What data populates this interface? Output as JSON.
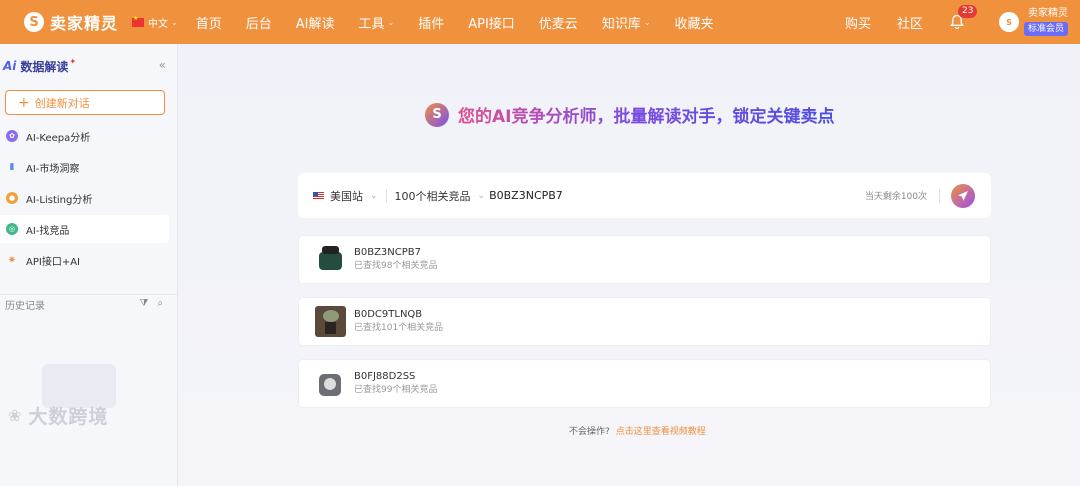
{
  "topnav": {
    "brand": "卖家精灵",
    "lang": "中文",
    "items": [
      "首页",
      "后台",
      "AI解读",
      "工具",
      "插件",
      "API接口",
      "优麦云",
      "知识库",
      "收藏夹"
    ],
    "right_items": [
      "购买",
      "社区"
    ],
    "notification_count": "23",
    "user_name": "卖家精灵",
    "member_badge": "标准会员"
  },
  "sidebar": {
    "title": "数据解读",
    "new_chat": "创建新对话",
    "items": [
      {
        "label": "AI-Keepa分析",
        "icon": "keepa-icon",
        "color": "#8a6cf0"
      },
      {
        "label": "AI-市场洞察",
        "icon": "bar-chart-icon",
        "color": "#5b8cf0"
      },
      {
        "label": "AI-Listing分析",
        "icon": "listing-icon",
        "color": "#f0a03e"
      },
      {
        "label": "AI-找竞品",
        "icon": "competitor-icon",
        "color": "#3fb98a"
      },
      {
        "label": "API接口+AI",
        "icon": "api-icon",
        "color": "#f0913e"
      }
    ],
    "history_label": "历史记录",
    "watermark": "大数跨境"
  },
  "main": {
    "headline": "您的AI竞争分析师，批量解读对手，锁定关键卖点",
    "search": {
      "marketplace": "美国站",
      "competitor_count": "100个相关竞品",
      "asin_value": "B0BZ3NCPB7",
      "remaining": "当天剩余100次"
    },
    "results": [
      {
        "asin": "B0BZ3NCPB7",
        "sub": "已查找98个相关竞品"
      },
      {
        "asin": "B0DC9TLNQB",
        "sub": "已查找101个相关竞品"
      },
      {
        "asin": "B0FJ88D2SS",
        "sub": "已查找99个相关竞品"
      }
    ],
    "help_prefix": "不会操作?",
    "help_link": "点击这里查看视频教程"
  }
}
